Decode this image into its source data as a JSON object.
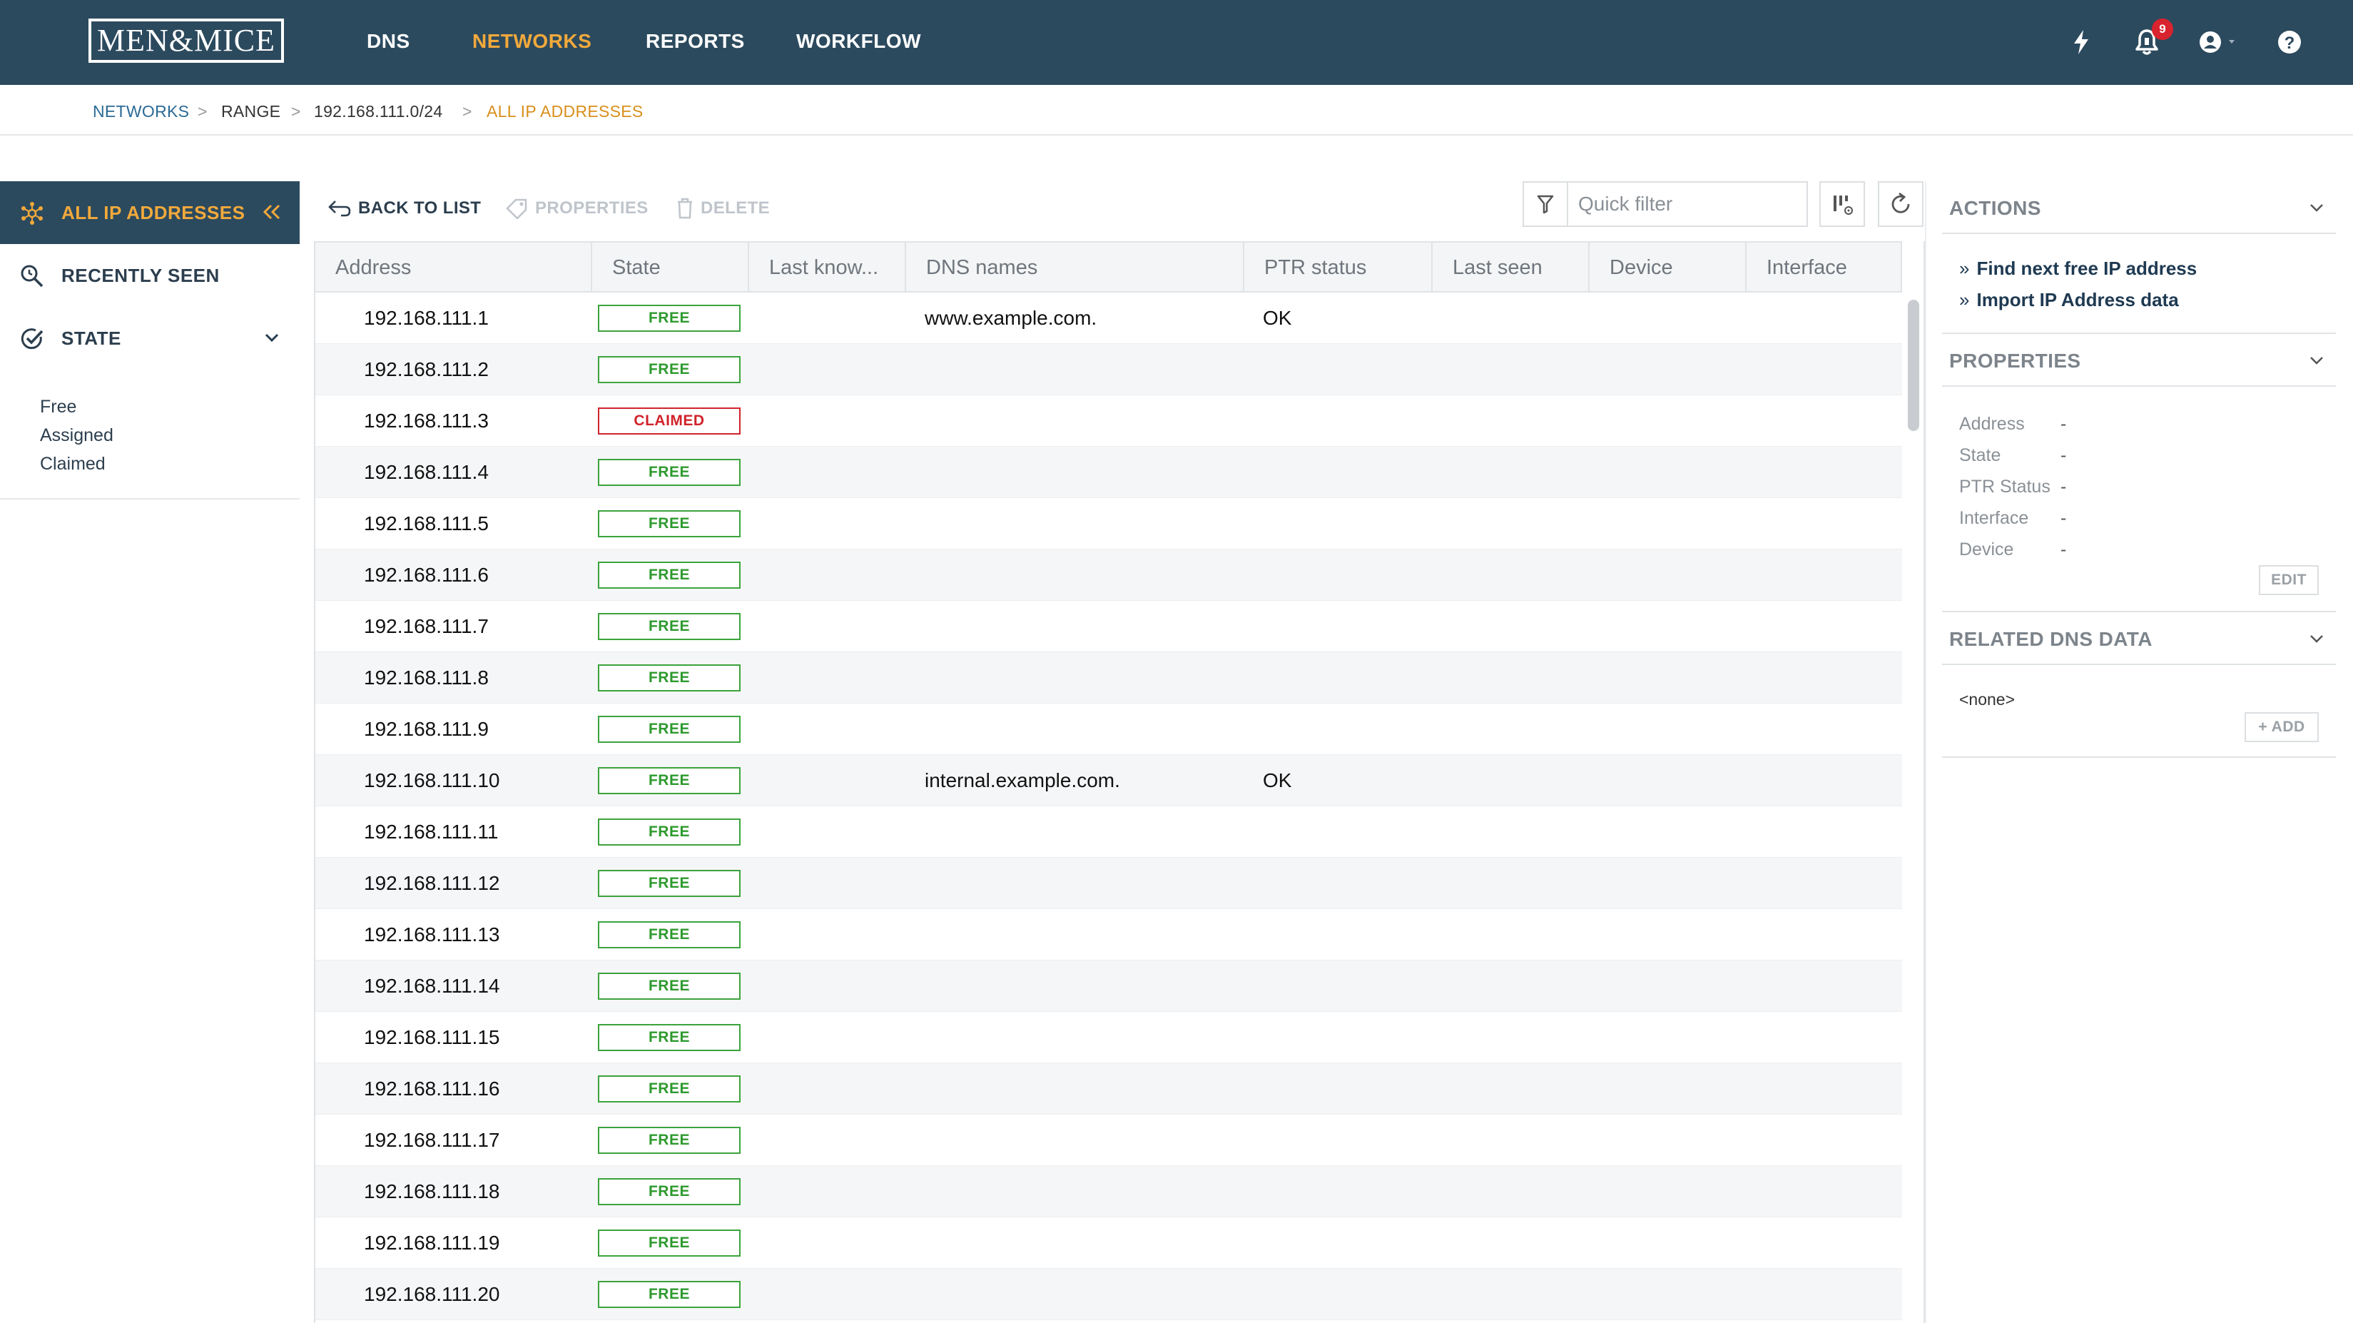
{
  "app": {
    "logo_text": "MEN&MICE"
  },
  "nav": {
    "items": [
      {
        "label": "DNS",
        "active": false
      },
      {
        "label": "NETWORKS",
        "active": true
      },
      {
        "label": "REPORTS",
        "active": false
      },
      {
        "label": "WORKFLOW",
        "active": false
      }
    ],
    "icons": [
      "lightning-icon",
      "notification-bell-icon",
      "user-account-icon",
      "help-icon"
    ],
    "notification_count": "9"
  },
  "breadcrumb": [
    {
      "label": "NETWORKS",
      "type": "link"
    },
    {
      "label": ">",
      "type": "sep"
    },
    {
      "label": "RANGE",
      "type": "plain"
    },
    {
      "label": ">",
      "type": "sep"
    },
    {
      "label": "192.168.111.0/24",
      "type": "plain"
    },
    {
      "label": ">",
      "type": "sep"
    },
    {
      "label": "ALL IP ADDRESSES",
      "type": "current"
    }
  ],
  "sidebar": {
    "items": [
      {
        "label": "ALL IP ADDRESSES",
        "icon": "network-hub-icon",
        "active": true
      },
      {
        "label": "RECENTLY SEEN",
        "icon": "search-history-icon",
        "active": false
      },
      {
        "label": "STATE",
        "icon": "check-circle-icon",
        "active": false
      }
    ],
    "state_options": [
      "Free",
      "Assigned",
      "Claimed"
    ]
  },
  "toolbar": {
    "back_label": "BACK TO LIST",
    "properties_label": "PROPERTIES",
    "delete_label": "DELETE",
    "filter_placeholder": "Quick filter"
  },
  "table": {
    "columns": [
      "Address",
      "State",
      "Last know...",
      "DNS names",
      "PTR status",
      "Last seen",
      "Device",
      "Interface"
    ],
    "rows": [
      {
        "address": "192.168.111.1",
        "state": "FREE",
        "dns": "www.example.com.",
        "ptr": "OK"
      },
      {
        "address": "192.168.111.2",
        "state": "FREE",
        "dns": "",
        "ptr": ""
      },
      {
        "address": "192.168.111.3",
        "state": "CLAIMED",
        "dns": "",
        "ptr": ""
      },
      {
        "address": "192.168.111.4",
        "state": "FREE",
        "dns": "",
        "ptr": ""
      },
      {
        "address": "192.168.111.5",
        "state": "FREE",
        "dns": "",
        "ptr": ""
      },
      {
        "address": "192.168.111.6",
        "state": "FREE",
        "dns": "",
        "ptr": ""
      },
      {
        "address": "192.168.111.7",
        "state": "FREE",
        "dns": "",
        "ptr": ""
      },
      {
        "address": "192.168.111.8",
        "state": "FREE",
        "dns": "",
        "ptr": ""
      },
      {
        "address": "192.168.111.9",
        "state": "FREE",
        "dns": "",
        "ptr": ""
      },
      {
        "address": "192.168.111.10",
        "state": "FREE",
        "dns": "internal.example.com.",
        "ptr": "OK"
      },
      {
        "address": "192.168.111.11",
        "state": "FREE",
        "dns": "",
        "ptr": ""
      },
      {
        "address": "192.168.111.12",
        "state": "FREE",
        "dns": "",
        "ptr": ""
      },
      {
        "address": "192.168.111.13",
        "state": "FREE",
        "dns": "",
        "ptr": ""
      },
      {
        "address": "192.168.111.14",
        "state": "FREE",
        "dns": "",
        "ptr": ""
      },
      {
        "address": "192.168.111.15",
        "state": "FREE",
        "dns": "",
        "ptr": ""
      },
      {
        "address": "192.168.111.16",
        "state": "FREE",
        "dns": "",
        "ptr": ""
      },
      {
        "address": "192.168.111.17",
        "state": "FREE",
        "dns": "",
        "ptr": ""
      },
      {
        "address": "192.168.111.18",
        "state": "FREE",
        "dns": "",
        "ptr": ""
      },
      {
        "address": "192.168.111.19",
        "state": "FREE",
        "dns": "",
        "ptr": ""
      },
      {
        "address": "192.168.111.20",
        "state": "FREE",
        "dns": "",
        "ptr": ""
      }
    ]
  },
  "right_panel": {
    "actions_title": "ACTIONS",
    "actions": [
      "Find next free IP address",
      "Import IP Address data"
    ],
    "properties_title": "PROPERTIES",
    "properties": [
      {
        "label": "Address",
        "value": "-"
      },
      {
        "label": "State",
        "value": "-"
      },
      {
        "label": "PTR Status",
        "value": "-"
      },
      {
        "label": "Interface",
        "value": "-"
      },
      {
        "label": "Device",
        "value": "-"
      }
    ],
    "edit_label": "EDIT",
    "related_title": "RELATED DNS DATA",
    "related_none": "<none>",
    "add_label": "ADD"
  },
  "colors": {
    "topbar": "#2c4a5e",
    "accent": "#f2a93b",
    "free": "#2e9a2e",
    "claimed": "#d0232b",
    "link": "#2b6a96"
  }
}
